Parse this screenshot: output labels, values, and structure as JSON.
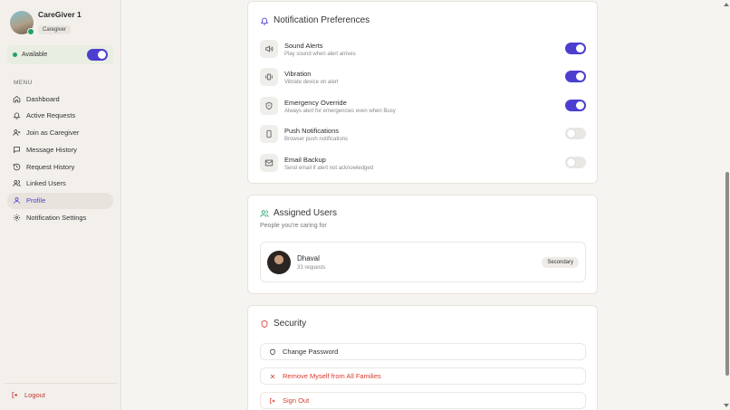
{
  "user": {
    "name": "CareGiver 1",
    "role": "Caregiver"
  },
  "status": {
    "label": "Available",
    "on": true
  },
  "menu": {
    "label": "MENU",
    "items": [
      {
        "label": "Dashboard",
        "icon": "home-icon"
      },
      {
        "label": "Active Requests",
        "icon": "bell-icon"
      },
      {
        "label": "Join as Caregiver",
        "icon": "user-plus-icon"
      },
      {
        "label": "Message History",
        "icon": "message-icon"
      },
      {
        "label": "Request History",
        "icon": "history-icon"
      },
      {
        "label": "Linked Users",
        "icon": "users-icon"
      },
      {
        "label": "Profile",
        "icon": "user-icon",
        "active": true
      },
      {
        "label": "Notification Settings",
        "icon": "gear-icon"
      }
    ]
  },
  "logout": "Logout",
  "notifications": {
    "title": "Notification Preferences",
    "items": [
      {
        "title": "Sound Alerts",
        "desc": "Play sound when alert arrives",
        "on": true,
        "icon": "speaker-icon"
      },
      {
        "title": "Vibration",
        "desc": "Vibrate device on alert",
        "on": true,
        "icon": "vibration-icon"
      },
      {
        "title": "Emergency Override",
        "desc": "Always alert for emergencies even when Busy",
        "on": true,
        "icon": "shield-icon"
      },
      {
        "title": "Push Notifications",
        "desc": "Browser push notifications",
        "on": false,
        "icon": "phone-icon"
      },
      {
        "title": "Email Backup",
        "desc": "Send email if alert not acknowledged",
        "on": false,
        "icon": "mail-icon"
      }
    ]
  },
  "assigned": {
    "title": "Assigned Users",
    "subtitle": "People you're caring for",
    "users": [
      {
        "name": "Dhaval",
        "requests": "33 requests",
        "badge": "Secondary"
      }
    ]
  },
  "security": {
    "title": "Security",
    "change_password": "Change Password",
    "remove": "Remove Myself from All Families",
    "sign_out": "Sign Out"
  },
  "colors": {
    "accent": "#4c3fcf",
    "danger": "#d93b2f",
    "available": "#22a06b"
  }
}
